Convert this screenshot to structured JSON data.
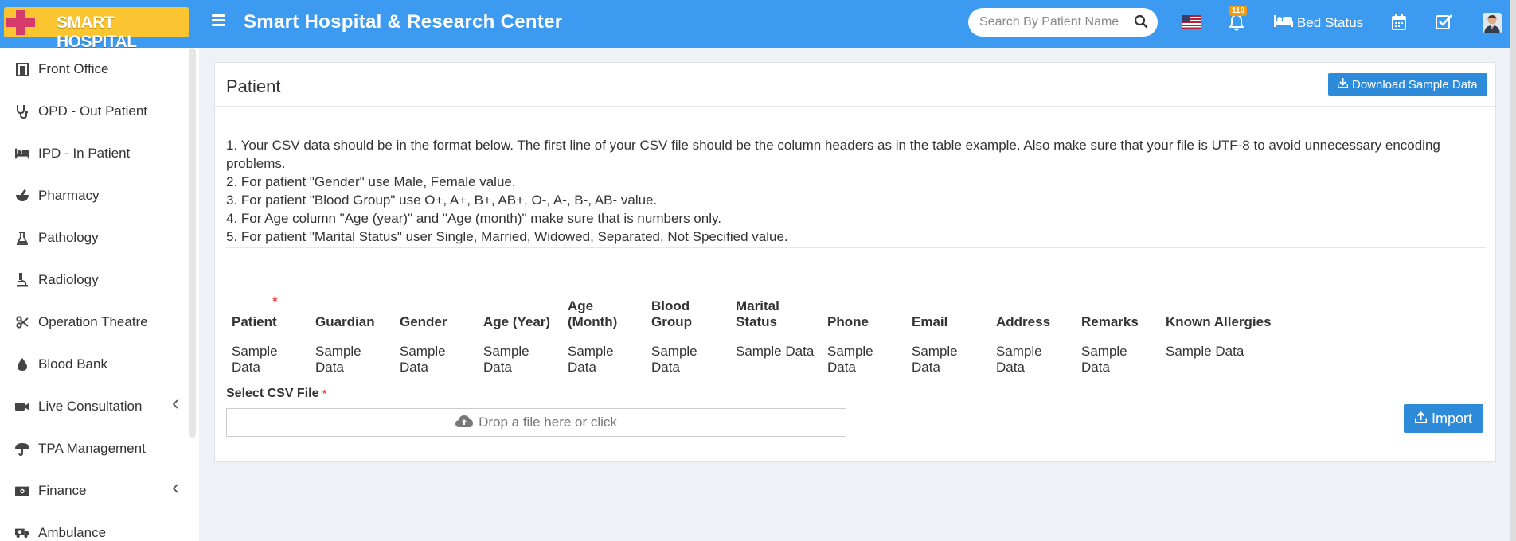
{
  "header": {
    "logo_text": "SMART HOSPITAL",
    "app_title": "Smart Hospital & Research Center",
    "search_placeholder": "Search By Patient Name",
    "notification_count": "119",
    "bed_status_label": "Bed Status"
  },
  "sidebar": {
    "items": [
      {
        "label": "Front Office",
        "icon": "door-icon"
      },
      {
        "label": "OPD - Out Patient",
        "icon": "stethoscope-icon"
      },
      {
        "label": "IPD - In Patient",
        "icon": "bed-icon"
      },
      {
        "label": "Pharmacy",
        "icon": "mortar-pestle-icon"
      },
      {
        "label": "Pathology",
        "icon": "flask-icon"
      },
      {
        "label": "Radiology",
        "icon": "microscope-icon"
      },
      {
        "label": "Operation Theatre",
        "icon": "scissors-icon"
      },
      {
        "label": "Blood Bank",
        "icon": "drop-icon"
      },
      {
        "label": "Live Consultation",
        "icon": "video-icon",
        "has_submenu": true
      },
      {
        "label": "TPA Management",
        "icon": "umbrella-icon"
      },
      {
        "label": "Finance",
        "icon": "money-icon",
        "has_submenu": true
      },
      {
        "label": "Ambulance",
        "icon": "ambulance-icon"
      }
    ]
  },
  "main": {
    "title": "Patient",
    "download_button": "Download Sample Data",
    "instructions": [
      "1. Your CSV data should be in the format below. The first line of your CSV file should be the column headers as in the table example. Also make sure that your file is UTF-8 to avoid unnecessary encoding problems.",
      "2. For patient \"Gender\" use Male, Female value.",
      "3. For patient \"Blood Group\" use O+, A+, B+, AB+, O-, A-, B-, AB- value.",
      "4. For Age column \"Age (year)\" and \"Age (month)\" make sure that is numbers only.",
      "5. For patient \"Marital Status\" user Single, Married, Widowed, Separated, Not Specified value."
    ],
    "table": {
      "headers": [
        "Patient",
        "Guardian",
        "Gender",
        "Age (Year)",
        "Age (Month)",
        "Blood Group",
        "Marital Status",
        "Phone",
        "Email",
        "Address",
        "Remarks",
        "Known Allergies"
      ],
      "required_marker": "*",
      "row": [
        "Sample Data",
        "Sample Data",
        "Sample Data",
        "Sample Data",
        "Sample Data",
        "Sample Data",
        "Sample Data",
        "Sample Data",
        "Sample Data",
        "Sample Data",
        "Sample Data",
        "Sample Data"
      ]
    },
    "csv_label": "Select CSV File",
    "dropzone_text": "Drop a file here or click",
    "import_button": "Import"
  },
  "colors": {
    "topbar": "#3c9af0",
    "primary_button": "#2d8bd9",
    "logo_bg": "#fbc531",
    "required": "#e74c3c"
  }
}
